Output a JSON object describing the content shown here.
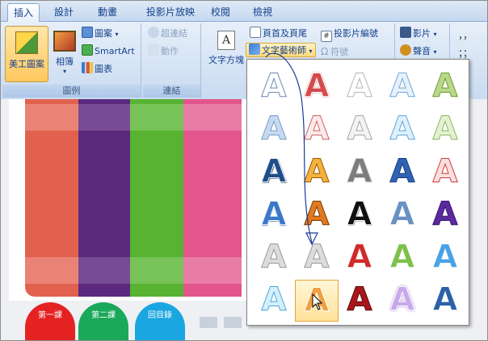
{
  "tabs": [
    {
      "label": "插入",
      "active": true
    },
    {
      "label": "設計"
    },
    {
      "label": "動畫"
    },
    {
      "label": "投影片放映"
    },
    {
      "label": "校閱"
    },
    {
      "label": "檢視"
    }
  ],
  "ribbon": {
    "illustrations": {
      "group_label": "圖例",
      "clipart_label": "美工圖案",
      "album_label": "相簿",
      "shapes_label": "圖案",
      "smartart_label": "SmartArt",
      "chart_label": "圖表"
    },
    "links": {
      "group_label": "連結",
      "hyperlink_label": "超連結",
      "action_label": "動作"
    },
    "text": {
      "textbox_label": "文字方塊",
      "header_footer_label": "頁首及頁尾",
      "slide_number_label": "投影片編號",
      "wordart_label": "文字藝術師",
      "symbol_label": "符號",
      "textbox_icon_glyph": "A",
      "slide_number_icon_glyph": "#",
      "symbol_icon_glyph": "Ω"
    },
    "media": {
      "movie_label": "影片",
      "sound_label": "聲音"
    }
  },
  "slide": {
    "buttons": [
      {
        "label": "第一課",
        "color": "#e52222"
      },
      {
        "label": "第二課",
        "color": "#1aa85a"
      },
      {
        "label": "回目錄",
        "color": "#1aa6e0"
      }
    ],
    "stripe_colors": [
      "#e2614e",
      "#5b2a7e",
      "#58b333",
      "#e2568c"
    ]
  },
  "wordart_gallery": {
    "glyph": "A",
    "rows": [
      [
        "plain",
        "red",
        "white",
        "lightblue",
        "green"
      ],
      [
        "softblue",
        "pink",
        "ghost",
        "skyblue",
        "lightgreen"
      ],
      [
        "navy",
        "gold",
        "gray",
        "blue",
        "redoutline"
      ],
      [
        "bluebright",
        "orange",
        "black",
        "steel",
        "purple"
      ],
      [
        "silver",
        "silver",
        "crimson",
        "lime",
        "azure"
      ],
      [
        "aqua",
        "amber",
        "maroon",
        "lavender",
        "cobalt"
      ]
    ],
    "selected": [
      5,
      1
    ]
  }
}
